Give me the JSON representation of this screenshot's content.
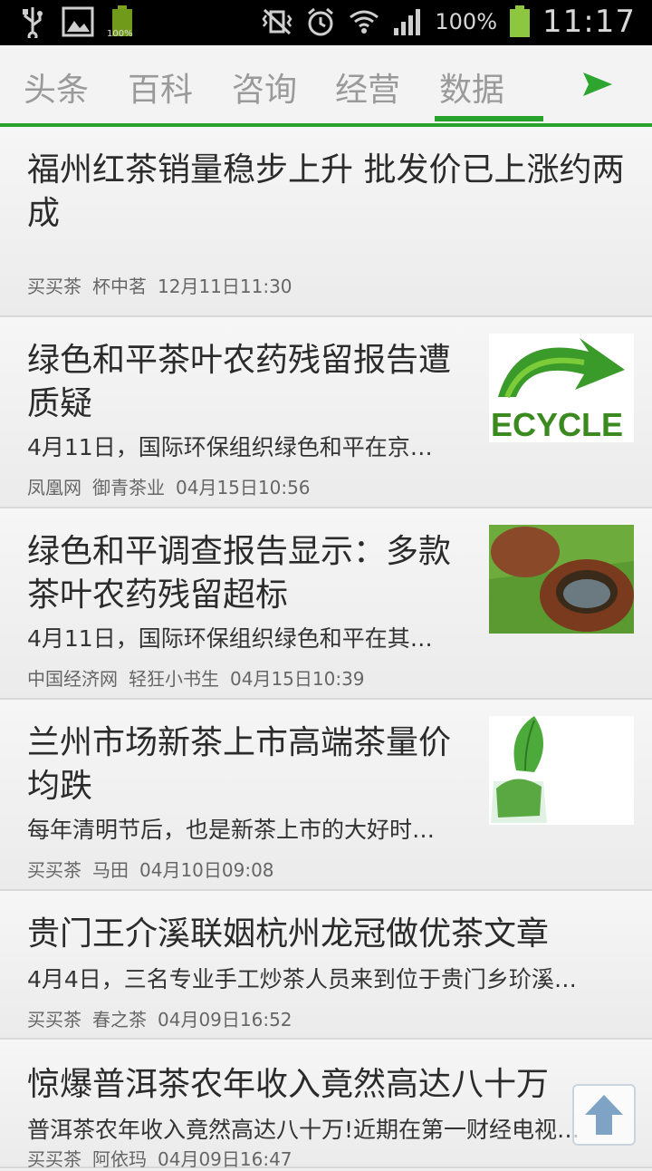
{
  "status": {
    "battery_percent": "100%",
    "small_battery": "100%",
    "time": "11:17"
  },
  "tabs": [
    {
      "label": "头条"
    },
    {
      "label": "百科"
    },
    {
      "label": "咨询"
    },
    {
      "label": "经营"
    },
    {
      "label": "数据"
    }
  ],
  "colors": {
    "accent": "#27a22b"
  },
  "articles": [
    {
      "title": "福州红茶销量稳步上升 批发价已上涨约两成",
      "summary": "",
      "source": "买买茶",
      "author": "杯中茗",
      "time": "12月11日11:30",
      "thumb": ""
    },
    {
      "title": "绿色和平茶叶农药残留报告遭质疑",
      "summary": "4月11日，国际环保组织绿色和平在京…",
      "source": "凤凰网",
      "author": "御青茶业",
      "time": "04月15日10:56",
      "thumb": "recycle-image"
    },
    {
      "title": "绿色和平调查报告显示：多款茶叶农药残留超标",
      "summary": "4月11日，国际环保组织绿色和平在其…",
      "source": "中国经济网",
      "author": "轻狂小书生",
      "time": "04月15日10:39",
      "thumb": "teapot-image"
    },
    {
      "title": "兰州市场新茶上市高端茶量价均跌",
      "summary": "每年清明节后，也是新茶上市的大好时…",
      "source": "买买茶",
      "author": "马田",
      "time": "04月10日09:08",
      "thumb": "tea-leaf-image"
    },
    {
      "title": "贵门王介溪联姻杭州龙冠做优茶文章",
      "summary": "4月4日，三名专业手工炒茶人员来到位于贵门乡玠溪…",
      "source": "买买茶",
      "author": "春之茶",
      "time": "04月09日16:52",
      "thumb": ""
    },
    {
      "title": "惊爆普洱茶农年收入竟然高达八十万",
      "summary": "普洱茶农年收入竟然高达八十万!近期在第一财经电视…",
      "source": "买买茶",
      "author": "阿依玛",
      "time": "04月09日16:47",
      "thumb": ""
    }
  ]
}
